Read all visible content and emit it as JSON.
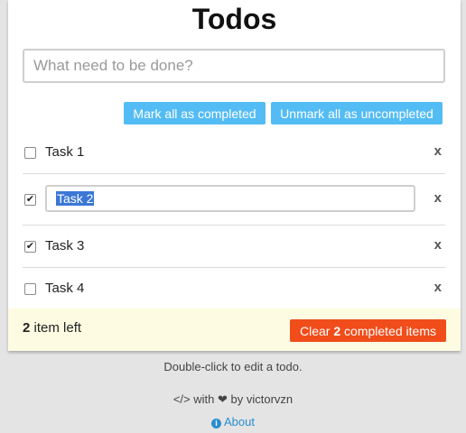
{
  "app": {
    "title": "Todos"
  },
  "new_todo": {
    "placeholder": "What need to be done?",
    "value": ""
  },
  "actions": {
    "mark_all_label": "Mark all as completed",
    "unmark_all_label": "Unmark all as uncompleted"
  },
  "todos": [
    {
      "label": "Task 1",
      "completed": false,
      "editing": false,
      "check": "",
      "delete": "x"
    },
    {
      "label": "Task 2",
      "completed": true,
      "editing": true,
      "check": "✔",
      "delete": "x"
    },
    {
      "label": "Task 3",
      "completed": true,
      "editing": false,
      "check": "✔",
      "delete": "x"
    },
    {
      "label": "Task 4",
      "completed": false,
      "editing": false,
      "check": "",
      "delete": "x"
    }
  ],
  "footer": {
    "count": "2",
    "count_suffix": " item left",
    "clear_prefix": "Clear ",
    "clear_count": "2",
    "clear_suffix": " completed items"
  },
  "hint": "Double-click to edit a todo.",
  "credit": {
    "prefix": "</> with ",
    "heart": "❤",
    "suffix": " by victorvzn"
  },
  "about": {
    "icon": "i",
    "label": "About"
  },
  "colors": {
    "accent_blue": "#54bcf4",
    "clear_red": "#f04d1b",
    "footer_bg": "#fdfbe2",
    "link_blue": "#2a8dd0"
  }
}
